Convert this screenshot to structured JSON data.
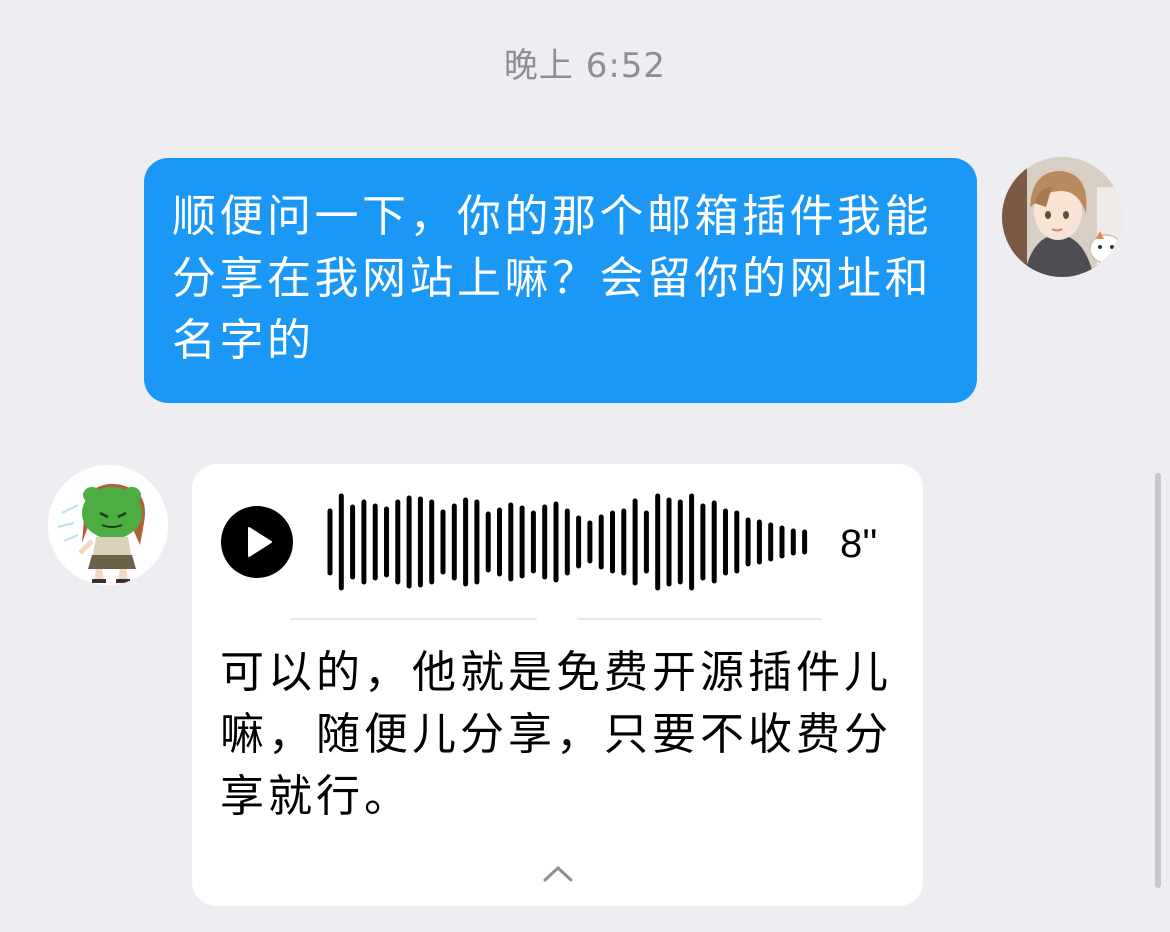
{
  "chat": {
    "timestamp": "晚上 6:52",
    "messages": [
      {
        "sender": "me",
        "type": "text",
        "text": "顺便问一下，你的那个邮箱插件我能分享在我网站上嘛？会留你的网址和名字的"
      },
      {
        "sender": "contact",
        "type": "voice",
        "duration": "8''",
        "transcript": "可以的，他就是免费开源插件儿嘛，随便儿分享，只要不收费分享就行。"
      }
    ]
  },
  "colors": {
    "background": "#ededf2",
    "sent_bubble": "#1b98f5",
    "received_bubble": "#ffffff",
    "timestamp_text": "#8e8e93"
  },
  "icons": {
    "play": "play-icon",
    "collapse": "chevron-up-icon",
    "waveform": "audio-waveform-icon"
  }
}
